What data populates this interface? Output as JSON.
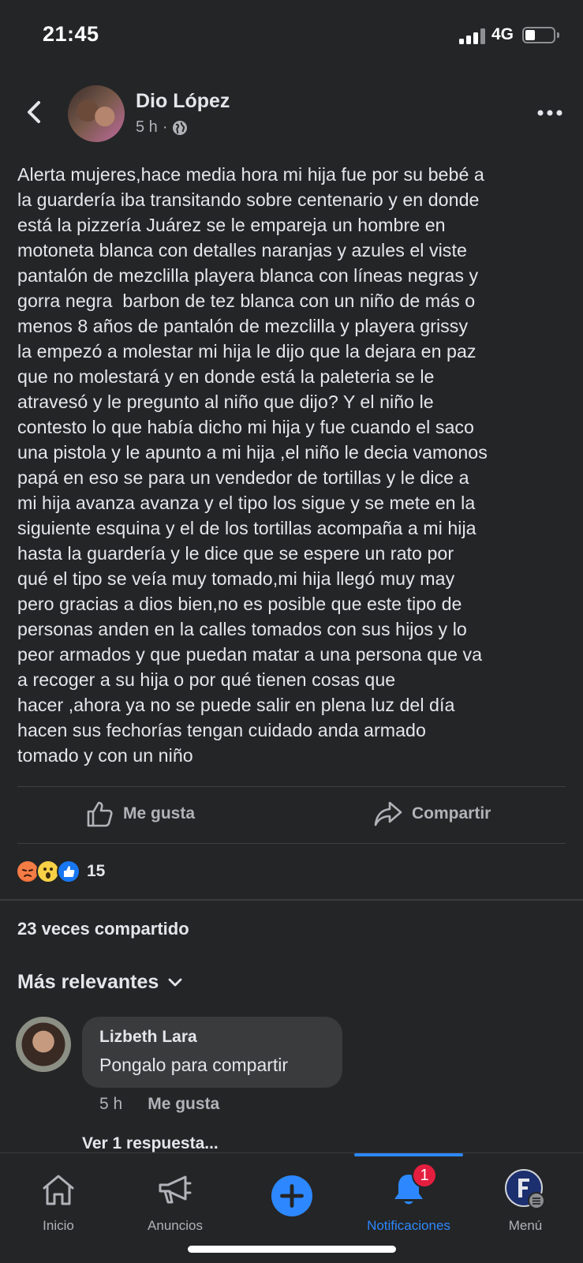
{
  "status_bar": {
    "time": "21:45",
    "network": "4G"
  },
  "post": {
    "author": "Dio López",
    "time": "5 h",
    "meta_separator": "·",
    "text": "Alerta mujeres,hace media hora mi hija fue por su bebé a\nla guardería iba transitando sobre centenario y en donde\nestá la pizzería Juárez se le empareja un hombre en\nmotoneta blanca con detalles naranjas y azules el viste\npantalón de mezclilla playera blanca con líneas negras y\ngorra negra  barbon de tez blanca con un niño de más o\nmenos 8 años de pantalón de mezclilla y playera grissy\nla empezó a molestar mi hija le dijo que la dejara en paz\nque no molestará y en donde está la paleteria se le\natravesó y le pregunto al niño que dijo? Y el niño le\ncontesto lo que había dicho mi hija y fue cuando el saco\nuna pistola y le apunto a mi hija ,el niño le decia vamonos\npapá en eso se para un vendedor de tortillas y le dice a\nmi hija avanza avanza y el tipo los sigue y se mete en la\nsiguiente esquina y el de los tortillas acompaña a mi hija\nhasta la guardería y le dice que se espere un rato por\nqué el tipo se veía muy tomado,mi hija llegó muy may\npero gracias a dios bien,no es posible que este tipo de\npersonas anden en la calles tomados con sus hijos y lo\npeor armados y que puedan matar a una persona que va\na recoger a su hija o por qué tienen cosas que\nhacer ,ahora ya no se puede salir en plena luz del día\nhacen sus fechorías tengan cuidado anda armado\ntomado y con un niño"
  },
  "actions": {
    "like": "Me gusta",
    "share": "Compartir"
  },
  "reactions": {
    "count": "15"
  },
  "shares_text": "23 veces compartido",
  "sort_label": "Más relevantes",
  "comment": {
    "author": "Lizbeth Lara",
    "text": "Pongalo para compartir",
    "time": "5 h",
    "like": "Me gusta",
    "replies": "Ver 1 respuesta..."
  },
  "nav": {
    "items": [
      {
        "label": "Inicio"
      },
      {
        "label": "Anuncios"
      },
      {
        "label": ""
      },
      {
        "label": "Notificaciones",
        "badge": "1"
      },
      {
        "label": "Menú"
      }
    ]
  },
  "colors": {
    "accent": "#2d88ff",
    "badge": "#e41e3f",
    "background": "#242526"
  }
}
